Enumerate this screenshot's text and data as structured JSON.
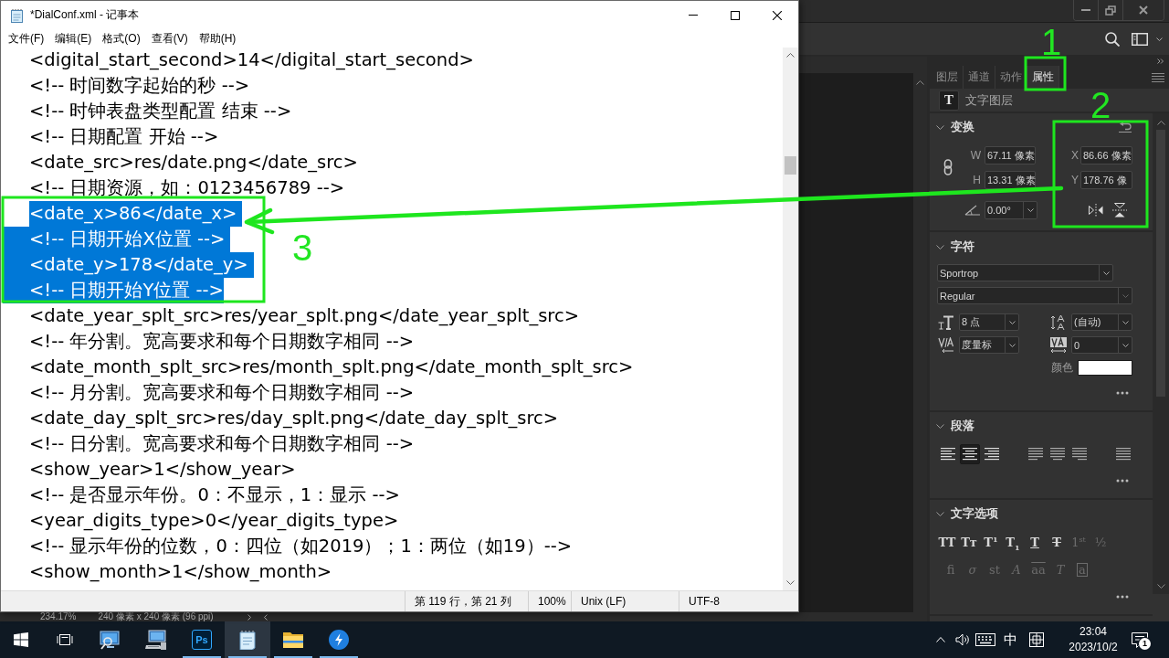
{
  "notepad_window": {
    "title": "*DialConf.xml - 记事本",
    "menu": [
      "文件(F)",
      "编辑(E)",
      "格式(O)",
      "查看(V)",
      "帮助(H)"
    ],
    "lines": [
      {
        "text": "<digital_start_second>14</digital_start_second>",
        "selected": false
      },
      {
        "text": "<!-- 时间数字起始的秒 -->",
        "selected": false
      },
      {
        "text": "<!-- 时钟表盘类型配置 结束 -->",
        "selected": false
      },
      {
        "text": "<!-- 日期配置 开始 -->",
        "selected": false
      },
      {
        "text": "<date_src>res/date.png</date_src>",
        "selected": false
      },
      {
        "text": "<!-- 日期资源，如：0123456789 -->",
        "selected": false
      },
      {
        "text": "<date_x>86</date_x>",
        "selected": true
      },
      {
        "text": "<!-- 日期开始X位置 -->",
        "selected": true
      },
      {
        "text": "<date_y>178</date_y>",
        "selected": true
      },
      {
        "text": "<!-- 日期开始Y位置 -->",
        "selected": true
      },
      {
        "text": "<date_year_splt_src>res/year_splt.png</date_year_splt_src>",
        "selected": false
      },
      {
        "text": "<!-- 年分割。宽高要求和每个日期数字相同 -->",
        "selected": false
      },
      {
        "text": "<date_month_splt_src>res/month_splt.png</date_month_splt_src>",
        "selected": false
      },
      {
        "text": "<!-- 月分割。宽高要求和每个日期数字相同 -->",
        "selected": false
      },
      {
        "text": "<date_day_splt_src>res/day_splt.png</date_day_splt_src>",
        "selected": false
      },
      {
        "text": "<!-- 日分割。宽高要求和每个日期数字相同 -->",
        "selected": false
      },
      {
        "text": "<show_year>1</show_year>",
        "selected": false
      },
      {
        "text": "<!-- 是否显示年份。0：不显示，1：显示 -->",
        "selected": false
      },
      {
        "text": "<year_digits_type>0</year_digits_type>",
        "selected": false
      },
      {
        "text": "<!-- 显示年份的位数，0：四位（如2019）；1：两位（如19）-->",
        "selected": false
      },
      {
        "text": "<show_month>1</show_month>",
        "selected": false
      }
    ],
    "status_bar": {
      "cursor_position": "第 119 行，第 21 列",
      "zoom": "100%",
      "line_ending": "Unix (LF)",
      "encoding": "UTF-8"
    }
  },
  "image_editor": {
    "status_bar": {
      "zoom": "234.17%",
      "document_size": "240 像素 x 240 像素 (96 ppi)"
    },
    "panel": {
      "tabs": [
        {
          "label": "图层",
          "selected": false
        },
        {
          "label": "通道",
          "selected": false
        },
        {
          "label": "动作",
          "selected": false
        },
        {
          "label": "属性",
          "selected": true
        }
      ],
      "layer_badge": "T",
      "layer_type": "文字图层",
      "transform": {
        "title": "变换",
        "expanded": true,
        "w_label": "W",
        "w_value": "67.11 像素",
        "h_label": "H",
        "h_value": "13.31 像素",
        "x_label": "X",
        "x_value": "86.66 像素",
        "y_label": "Y",
        "y_value": "178.76 像",
        "angle": "0.00°"
      },
      "character": {
        "title": "字符",
        "expanded": true,
        "font_family": "Sportrop",
        "font_style": "Regular",
        "font_size": "8 点",
        "leading": "(自动)",
        "kerning": "度量标",
        "tracking": "0",
        "color_label": "颜色",
        "color": "#ffffff"
      },
      "paragraph": {
        "title": "段落",
        "expanded": true,
        "alignments": [
          {
            "kind": "left",
            "selected": false
          },
          {
            "kind": "center",
            "selected": true
          },
          {
            "kind": "right",
            "selected": false
          },
          {
            "kind": "justify-left",
            "selected": false
          },
          {
            "kind": "justify-center",
            "selected": false
          },
          {
            "kind": "justify-right",
            "selected": false
          },
          {
            "kind": "justify-all",
            "selected": false
          }
        ]
      },
      "text_options": {
        "title": "文字选项",
        "expanded": true,
        "row_1": [
          {
            "label": "TT",
            "kind": "plain",
            "disabled": false
          },
          {
            "label": "Tᴛ",
            "kind": "plain",
            "disabled": false
          },
          {
            "label": "T$^{1}$",
            "kind": "plain",
            "disabled": false
          },
          {
            "label": "T$_{1}$",
            "kind": "plain",
            "disabled": false
          },
          {
            "label": "T",
            "kind": "underline",
            "disabled": false
          },
          {
            "label": "T",
            "kind": "strikethrough",
            "disabled": false
          },
          {
            "label": "1$^{st}$",
            "kind": "plain",
            "disabled": true
          },
          {
            "label": "½",
            "kind": "plain",
            "disabled": true
          }
        ],
        "row_2": [
          {
            "label": "fi",
            "kind": "plain",
            "disabled": true
          },
          {
            "label": "σ",
            "kind": "italic",
            "disabled": true
          },
          {
            "label": "st",
            "kind": "plain",
            "disabled": true
          },
          {
            "label": "A",
            "kind": "italic",
            "disabled": true
          },
          {
            "label": "aa",
            "kind": "overline",
            "disabled": true
          },
          {
            "label": "T",
            "kind": "italic",
            "disabled": true
          },
          {
            "label": "a",
            "kind": "boxed",
            "disabled": true
          }
        ]
      }
    }
  },
  "annotations": [
    {
      "label": "1"
    },
    {
      "label": "2"
    },
    {
      "label": "3"
    }
  ],
  "taskbar": {
    "apps": [
      {
        "kind": "start",
        "open": false,
        "selected": false
      },
      {
        "kind": "taskview",
        "open": false,
        "selected": false
      },
      {
        "kind": "monitor",
        "open": false,
        "selected": false
      },
      {
        "kind": "computer",
        "open": false,
        "selected": false
      },
      {
        "kind": "photo",
        "label": "Ps",
        "open": true,
        "selected": false
      },
      {
        "kind": "notepad",
        "open": true,
        "selected": true
      },
      {
        "kind": "folder",
        "open": true,
        "selected": false
      },
      {
        "kind": "bolt",
        "open": true,
        "selected": false
      }
    ],
    "tray": {
      "input_method": "中",
      "time": "23:04",
      "date": "2023/10/2",
      "notification_count": "1"
    }
  }
}
